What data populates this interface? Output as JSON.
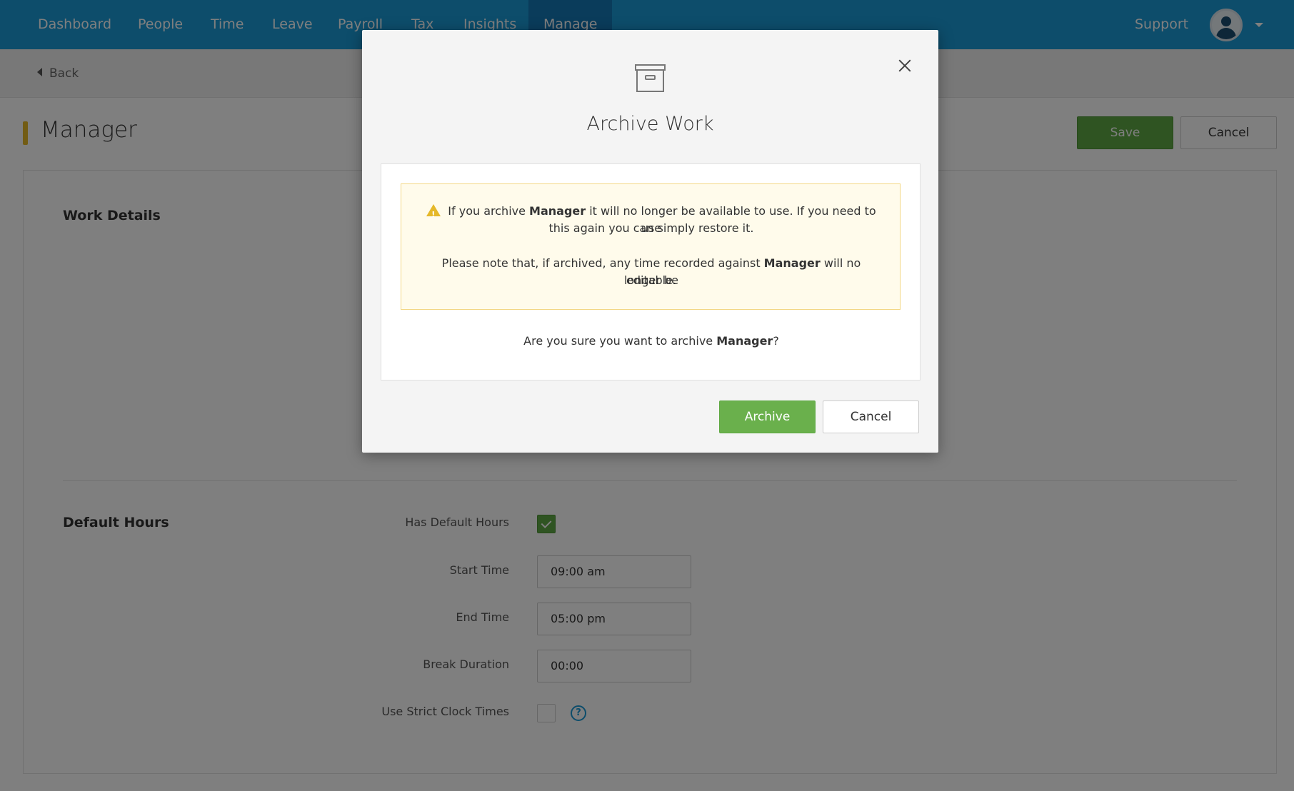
{
  "nav": {
    "items": [
      {
        "label": "Dashboard"
      },
      {
        "label": "People"
      },
      {
        "label": "Time"
      },
      {
        "label": "Leave"
      },
      {
        "label": "Payroll"
      },
      {
        "label": "Tax"
      },
      {
        "label": "Insights"
      },
      {
        "label": "Manage",
        "active": true
      }
    ],
    "support": "Support",
    "avatar_icon": "user-avatar-icon"
  },
  "subbar": {
    "back_label": "Back"
  },
  "page": {
    "title": "Manager",
    "accent_color": "#e5b829",
    "save_label": "Save",
    "cancel_label": "Cancel"
  },
  "sections": {
    "work_details": {
      "title": "Work Details"
    },
    "default_hours": {
      "title": "Default Hours",
      "has_default_hours": {
        "label": "Has Default Hours",
        "checked": true
      },
      "start_time": {
        "label": "Start Time",
        "value": "09:00  am"
      },
      "end_time": {
        "label": "End Time",
        "value": "05:00  pm"
      },
      "break_duration": {
        "label": "Break Duration",
        "value": "00:00"
      },
      "strict_clock": {
        "label": "Use Strict Clock Times",
        "checked": false,
        "help": "?"
      }
    }
  },
  "modal": {
    "title": "Archive Work",
    "icon": "archive-box-icon",
    "warning": {
      "line1_pre": "If you archive ",
      "line1_bold": "Manager",
      "line1_post": " it will no longer be available to use. If you need to use",
      "line2": "this again you can simply restore it.",
      "line3_pre": "Please note that, if archived, any time recorded against ",
      "line3_bold": "Manager",
      "line3_post": " will no longer be",
      "line4": "editable."
    },
    "confirm": {
      "pre": "Are you sure you want to archive ",
      "bold": "Manager",
      "post": "?"
    },
    "archive_label": "Archive",
    "cancel_label": "Cancel"
  },
  "colors": {
    "nav_bg": "#1a9ad6",
    "nav_active": "#1578b6",
    "primary_green": "#5fa944",
    "warning_bg": "#fffbeb",
    "warning_border": "#f3d785"
  }
}
